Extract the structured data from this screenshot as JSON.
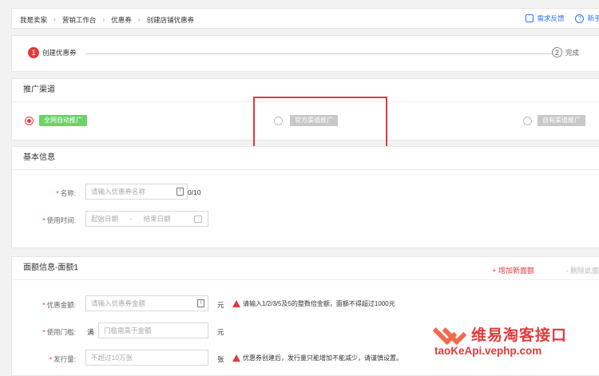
{
  "breadcrumb": [
    "我是卖家",
    "营销工作台",
    "优惠券",
    "创建店铺优惠券"
  ],
  "top_links": {
    "feedback": "需求反馈",
    "help": "新手动"
  },
  "steps": [
    {
      "num": "1",
      "label": "创建优惠券"
    },
    {
      "num": "2",
      "label": "完成"
    }
  ],
  "channel": {
    "title": "推广渠道",
    "options": [
      {
        "label": "全网自动推广",
        "selected": true
      },
      {
        "label": "官方渠道推广",
        "selected": false
      },
      {
        "label": "自有渠道推广",
        "selected": false
      }
    ]
  },
  "basic": {
    "title": "基本信息",
    "name_label": "名称:",
    "name_placeholder": "请输入优惠券名称",
    "name_count": "0/10",
    "time_label": "使用时间:",
    "start_placeholder": "起始日期",
    "dash": "-",
    "end_placeholder": "结束日期"
  },
  "face": {
    "title": "面额信息-面额1",
    "add_link": "+ 增加新面额",
    "del_link": "- 删除此面额",
    "amount_label": "优惠金额:",
    "amount_placeholder": "请输入优惠券金额",
    "amount_unit": "元",
    "amount_hint": "请输入1/2/3/5及5的整数倍金额，面额不得超过1000元",
    "threshold_label": "使用门槛:",
    "threshold_prefix": "满",
    "threshold_placeholder": "门槛需高于金额",
    "threshold_unit": "元",
    "issue_label": "发行量:",
    "issue_placeholder": "不超过10万张",
    "issue_unit": "张",
    "issue_hint": "优惠券创建后，发行量只能增加不能减少，请谨慎设置。"
  },
  "watermark": {
    "title": "维易淘客接口",
    "url": "taoKeApi.vephp.com"
  },
  "colors": {
    "accent_red": "#e4393c",
    "link_blue": "#3072f6",
    "chip_green": "#6ad36a"
  }
}
